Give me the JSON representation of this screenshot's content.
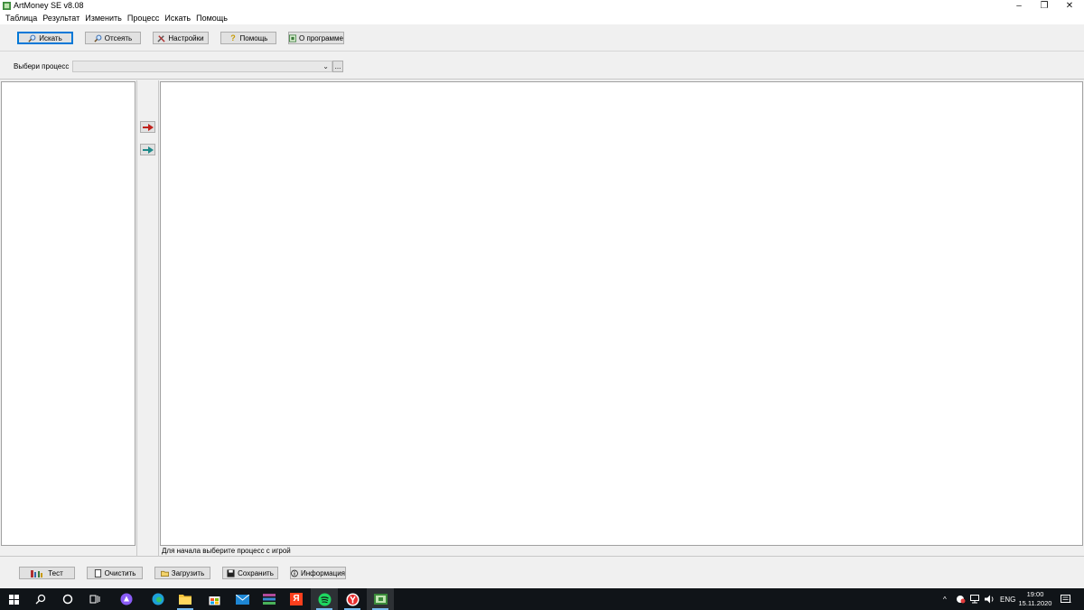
{
  "window": {
    "title": "ArtMoney SE v8.08",
    "minimize_glyph": "–",
    "restore_glyph": "❐",
    "close_glyph": "✕"
  },
  "menu": [
    "Таблица",
    "Результат",
    "Изменить",
    "Процесс",
    "Искать",
    "Помощь"
  ],
  "toolbar": {
    "search": "Искать",
    "filter": "Отсеять",
    "settings": "Настройки",
    "help": "Помощь",
    "about": "О программе"
  },
  "process": {
    "label": "Выбери процесс",
    "value": "",
    "browse": "..."
  },
  "status": "Для начала выберите процесс с игрой",
  "bottom": {
    "test": "Тест",
    "clear": "Очистить",
    "load": "Загрузить",
    "save": "Сохранить",
    "info": "Информация"
  },
  "taskbar": {
    "lang": "ENG",
    "time": "19:00",
    "date": "15.11.2020",
    "notifications": "1"
  },
  "colors": {
    "accent": "#0078d7",
    "arrow_red": "#c0221c",
    "arrow_teal": "#1f8a8a"
  }
}
